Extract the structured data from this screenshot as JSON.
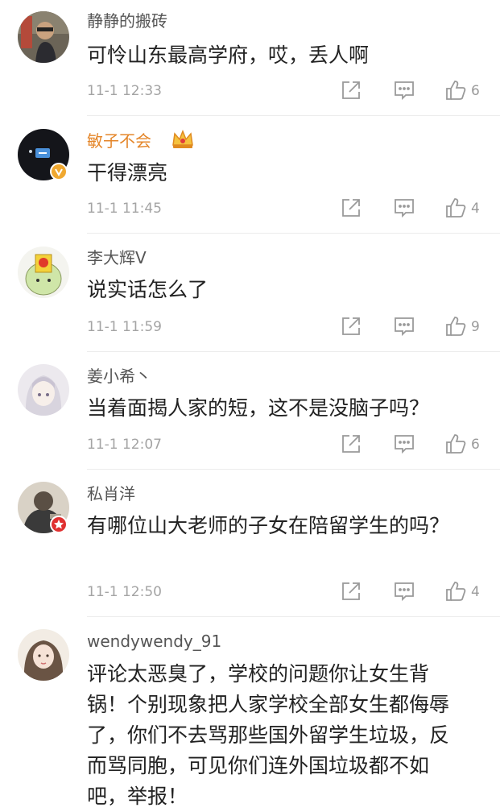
{
  "comments": [
    {
      "user": "静静的搬砖",
      "text": "可怜山东最高学府，哎，丢人啊",
      "time": "11-1 12:33",
      "likes": "6"
    },
    {
      "user": "敏子不会",
      "text": "干得漂亮",
      "time": "11-1 11:45",
      "likes": "4"
    },
    {
      "user": "李大辉V",
      "text": "说实话怎么了",
      "time": "11-1 11:59",
      "likes": "9"
    },
    {
      "user": "姜小希丶",
      "text": "当着面揭人家的短，这不是没脑子吗？",
      "time": "11-1 12:07",
      "likes": "6"
    },
    {
      "user": "私肖洋",
      "text": "有哪位山大老师的子女在陪留学生的吗？",
      "time": "11-1 12:50",
      "likes": "4"
    },
    {
      "user": "wendywendy_91",
      "text": "评论太恶臭了，学校的问题你让女生背锅！个别现象把人家学校全部女生都侮辱了，你们不去骂那些国外留学生垃圾，反而骂同胞，可见你们连外国垃圾都不如吧，举报！"
    }
  ],
  "colors": {
    "vip_name": "#e4862a",
    "verified_badge": "#f0a830",
    "red_badge": "#e03030",
    "icon_gray": "#9a9a9a"
  },
  "icons": [
    "share-icon",
    "comment-icon",
    "like-icon",
    "vip-crown-icon"
  ]
}
